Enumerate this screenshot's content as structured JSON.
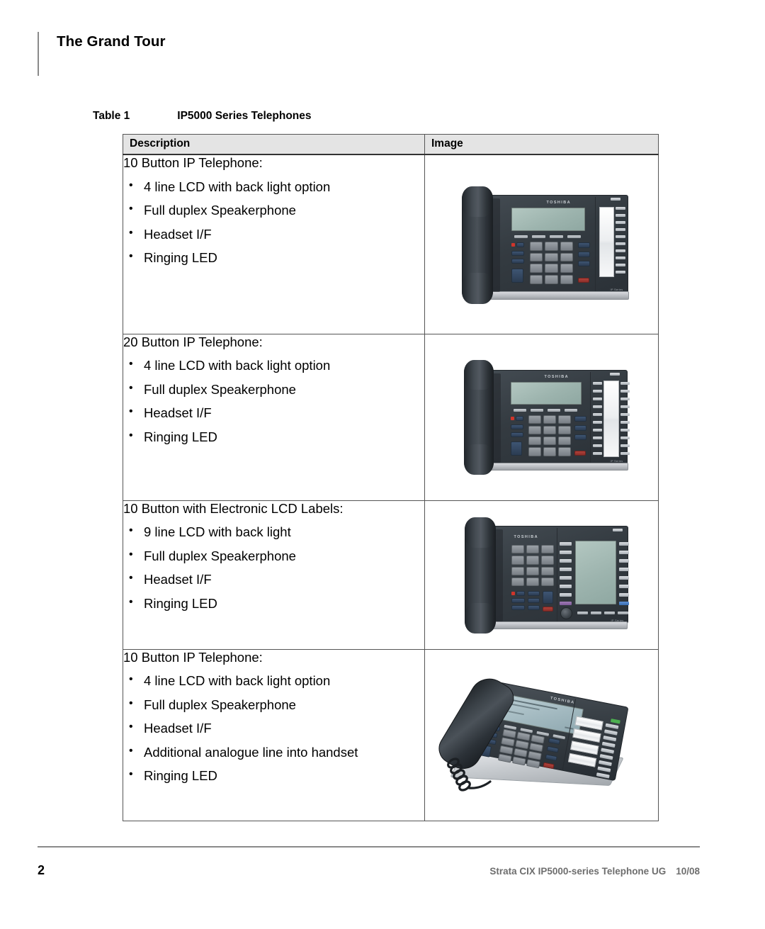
{
  "header": {
    "running_title": "The Grand Tour"
  },
  "table": {
    "caption_label": "Table 1",
    "caption_title": "IP5000 Series Telephones",
    "columns": [
      {
        "key": "description",
        "label": "Description"
      },
      {
        "key": "image",
        "label": "Image"
      }
    ],
    "rows": [
      {
        "title": "10 Button IP Telephone:",
        "features": [
          "4 line LCD with back light option",
          "Full duplex Speakerphone",
          "Headset I/F",
          "Ringing LED"
        ],
        "image_alt": "Toshiba 10-button IP telephone, front view with 10-key DSS panel on right"
      },
      {
        "title": "20 Button IP Telephone:",
        "features": [
          "4 line LCD with back light option",
          "Full duplex Speakerphone",
          "Headset I/F",
          "Ringing LED"
        ],
        "image_alt": "Toshiba 20-button IP telephone, front view with two 10-key DSS columns on right"
      },
      {
        "title": "10 Button with Electronic LCD Labels:",
        "features": [
          "9 line LCD with back light",
          "Full duplex Speakerphone",
          "Headset I/F",
          "Ringing LED"
        ],
        "image_alt": "Toshiba 10-button IP telephone with large electronic LCD label display on right"
      },
      {
        "title": "10 Button IP Telephone:",
        "features": [
          "4 line LCD with back light option",
          "Full duplex Speakerphone",
          "Headset I/F",
          "Additional analogue line into handset",
          "Ringing LED"
        ],
        "image_alt": "Toshiba 10-button IP telephone, three-quarter angled view on silver desk stand"
      }
    ]
  },
  "phone_brand": "TOSHIBA",
  "footer": {
    "page_number": "2",
    "document_title": "Strata CIX IP5000-series Telephone UG",
    "document_date": "10/08"
  },
  "colors": {
    "table_border": "#555555",
    "header_fill": "#e4e4e4",
    "rule": "#8a8a8a",
    "footer_text": "#6e6e6e",
    "phone_body": "#3a4147",
    "lcd": "#9db4ae",
    "feature_button": "#2b3c52",
    "red_button": "#b0413a",
    "green_led": "#4caf50"
  }
}
